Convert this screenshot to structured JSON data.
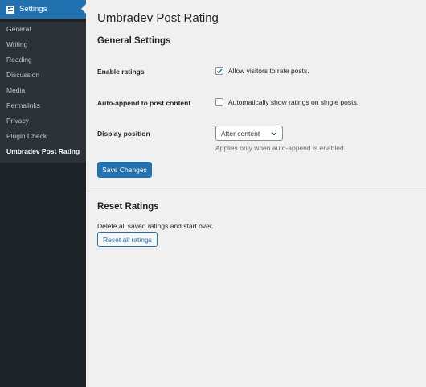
{
  "sidebar": {
    "header_label": "Settings",
    "header_icon": "settings-icon",
    "items": [
      {
        "label": "General"
      },
      {
        "label": "Writing"
      },
      {
        "label": "Reading"
      },
      {
        "label": "Discussion"
      },
      {
        "label": "Media"
      },
      {
        "label": "Permalinks"
      },
      {
        "label": "Privacy"
      },
      {
        "label": "Plugin Check"
      },
      {
        "label": "Umbradev Post Rating",
        "current": true
      }
    ]
  },
  "page": {
    "title": "Umbradev Post Rating"
  },
  "general": {
    "heading": "General Settings",
    "enable_label": "Enable ratings",
    "enable_checkbox_text": "Allow visitors to rate posts.",
    "enable_checked": true,
    "autoappend_label": "Auto-append to post content",
    "autoappend_checkbox_text": "Automatically show ratings on single posts.",
    "autoappend_checked": false,
    "position_label": "Display position",
    "position_selected": "After content",
    "position_description": "Applies only when auto-append is enabled.",
    "save_button": "Save Changes"
  },
  "reset": {
    "heading": "Reset Ratings",
    "description": "Delete all saved ratings and start over.",
    "button": "Reset all ratings"
  },
  "colors": {
    "accent": "#2271b1",
    "sidebar_bg": "#1d2327",
    "submenu_bg": "#2c3338",
    "page_bg": "#f0f0f1"
  }
}
